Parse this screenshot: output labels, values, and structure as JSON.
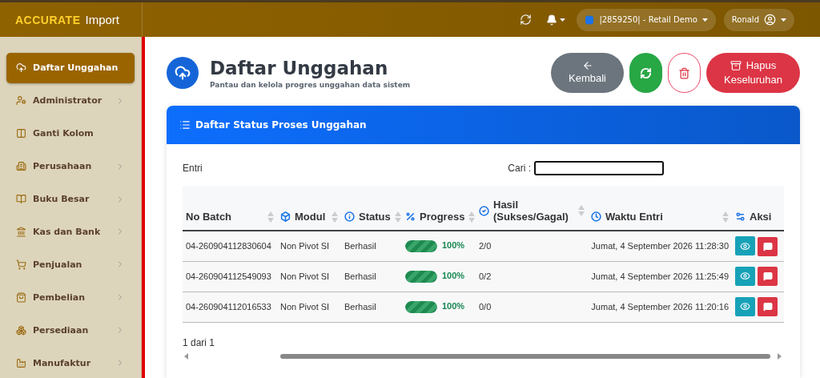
{
  "header": {
    "brand": "ACCURATE",
    "brand_suffix": "Import",
    "company": "|2859250| - Retail Demo",
    "user": "Ronald"
  },
  "sidebar": {
    "items": [
      {
        "label": "Daftar Unggahan",
        "selected": true,
        "has_submenu": false
      },
      {
        "label": "Administrator",
        "selected": false,
        "has_submenu": true
      },
      {
        "label": "Ganti Kolom",
        "selected": false,
        "has_submenu": false
      },
      {
        "label": "Perusahaan",
        "selected": false,
        "has_submenu": true
      },
      {
        "label": "Buku Besar",
        "selected": false,
        "has_submenu": true
      },
      {
        "label": "Kas dan Bank",
        "selected": false,
        "has_submenu": true
      },
      {
        "label": "Penjualan",
        "selected": false,
        "has_submenu": true
      },
      {
        "label": "Pembelian",
        "selected": false,
        "has_submenu": true
      },
      {
        "label": "Persediaan",
        "selected": false,
        "has_submenu": true
      },
      {
        "label": "Manufaktur",
        "selected": false,
        "has_submenu": true
      }
    ]
  },
  "page": {
    "title": "Daftar Unggahan",
    "subtitle": "Pantau dan kelola progres unggahan data sistem"
  },
  "buttons": [
    {
      "kind": "back",
      "label": "Kembali"
    },
    {
      "kind": "refresh"
    },
    {
      "kind": "delete"
    },
    {
      "kind": "delete_all",
      "label": "Hapus Keseluruhan"
    }
  ],
  "card": {
    "title": "Daftar Status Proses Unggahan",
    "entries_label": "Entri",
    "search_label": "Cari :",
    "pagination": "1 dari 1"
  },
  "table": {
    "columns": [
      {
        "label": "No Batch",
        "sortable": true
      },
      {
        "label": "Modul",
        "sortable": true
      },
      {
        "label": "Status",
        "sortable": true
      },
      {
        "label": "Progress",
        "sortable": true
      },
      {
        "label": "Hasil (Sukses/Gagal)",
        "sortable": true
      },
      {
        "label": "Waktu Entri",
        "sortable": true
      },
      {
        "label": "Aksi",
        "sortable": false
      }
    ],
    "rows": [
      {
        "no_batch": "04-260904112830604",
        "modul": "Non Pivot SI",
        "status": "Berhasil",
        "level": 1,
        "percent": "100%",
        "hasil": "2/0",
        "waktu": "Jumat, 4 September 2026 11:28:30"
      },
      {
        "no_batch": "04-260904112549093",
        "modul": "Non Pivot SI",
        "status": "Berhasil",
        "level": 1,
        "percent": "100%",
        "hasil": "0/2",
        "waktu": "Jumat, 4 September 2026 11:25:49"
      },
      {
        "no_batch": "04-260904112016533",
        "modul": "Non Pivot SI",
        "status": "Berhasil",
        "level": 1,
        "percent": "100%",
        "hasil": "0/0",
        "waktu": "Jumat, 4 September 2026 11:20:16"
      }
    ]
  }
}
